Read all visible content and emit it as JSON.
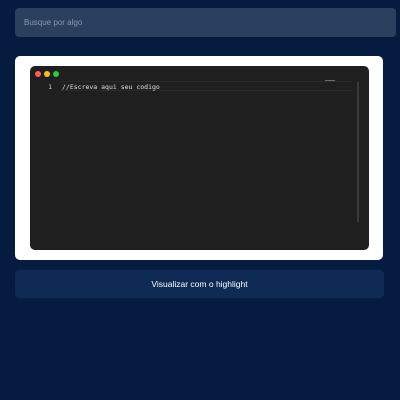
{
  "search": {
    "placeholder": "Busque por algo",
    "value": ""
  },
  "editor": {
    "window_controls": [
      {
        "name": "close",
        "color": "#ff5f56"
      },
      {
        "name": "minimize",
        "color": "#ffbd2e"
      },
      {
        "name": "maximize",
        "color": "#27c93f"
      }
    ],
    "lines": [
      {
        "number": "1",
        "text": "//Escreva aqui seu codigo"
      }
    ]
  },
  "actions": {
    "highlight_label": "Visualizar com o highlight"
  },
  "colors": {
    "page_background": "#051b3f",
    "search_background": "#2b3f5e",
    "button_background": "#0f2a54",
    "editor_background": "#1f1f1f",
    "card_background": "#ffffff"
  }
}
